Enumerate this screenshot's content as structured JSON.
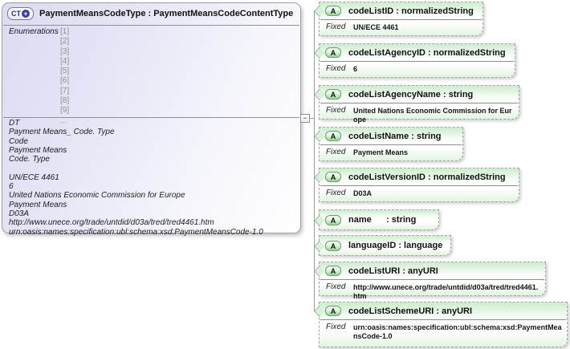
{
  "main_box": {
    "icon_text": "CT",
    "icon_plus": "+",
    "title": "PaymentMeansCodeType : PaymentMeansCodeContentType",
    "enumerations_label": "Enumerations",
    "enumerations": [
      "[1]",
      "[2]",
      "[3]",
      "[4]",
      "[5]",
      "[6]",
      "[7]",
      "[8]",
      "[9]",
      "..."
    ],
    "description_lines": [
      "DT",
      "Payment Means_ Code. Type",
      "Code",
      "Payment Means",
      "Code. Type",
      "",
      "UN/ECE 4461",
      "6",
      "United Nations Economic Commission for Europe",
      "Payment Means",
      "D03A",
      "http://www.unece.org/trade/untdid/d03a/tred/tred4461.htm",
      "urn:oasis:names:specification:ubl:schema:xsd:PaymentMeansCode-1.0"
    ]
  },
  "collapse_button": "−",
  "attribute_icon": "A",
  "fixed_label": "Fixed",
  "attributes": [
    {
      "title": "codeListID : normalizedString",
      "fixed": "UN/ECE 4461"
    },
    {
      "title": "codeListAgencyID : normalizedString",
      "fixed": "6"
    },
    {
      "title": "codeListAgencyName : string",
      "fixed": "United Nations Economic Commission for Europe"
    },
    {
      "title": "codeListName : string",
      "fixed": "Payment Means"
    },
    {
      "title": "codeListVersionID : normalizedString",
      "fixed": "D03A"
    },
    {
      "title": "name      : string"
    },
    {
      "title": "languageID : language"
    },
    {
      "title": "codeListURI : anyURI",
      "fixed": "http://www.unece.org/trade/untdid/d03a/tred/tred4461.htm"
    },
    {
      "title": "codeListSchemeURI : anyURI",
      "fixed": "urn:oasis:names:specification:ubl:schema:xsd:PaymentMeansCode-1.0"
    }
  ],
  "colors": {
    "main_box_fill": "#dcdcf2",
    "attribute_box_fill": "#cdeccd",
    "attribute_icon_fill": "#94d894",
    "ct_icon_text": "#2c2c86",
    "connector": "#9a9a9e",
    "enum_value_text": "#8f8f93"
  }
}
